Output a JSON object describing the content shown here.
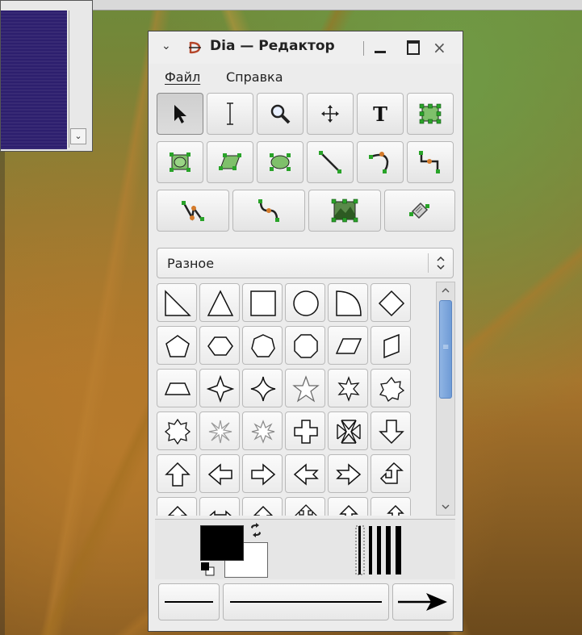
{
  "window": {
    "title": "Dia — Редактор",
    "menu_glyph": "⌄",
    "close_glyph": "×"
  },
  "menubar": {
    "file": "Файл",
    "help": "Справка"
  },
  "toolbox": {
    "tools": [
      {
        "name": "pointer-tool",
        "icon": "arrow-pointer-icon",
        "active": true
      },
      {
        "name": "text-edit-tool",
        "icon": "text-cursor-icon"
      },
      {
        "name": "magnify-tool",
        "icon": "magnifier-icon"
      },
      {
        "name": "scroll-tool",
        "icon": "move-icon"
      },
      {
        "name": "text-tool",
        "icon": "text-T-icon"
      },
      {
        "name": "box-tool",
        "icon": "box-icon"
      },
      {
        "name": "ellipse-box-tool",
        "icon": "ellipse-box-icon"
      },
      {
        "name": "polygon-tool",
        "icon": "parallelogram-icon"
      },
      {
        "name": "ellipse-tool",
        "icon": "ellipse-icon"
      },
      {
        "name": "line-tool",
        "icon": "line-icon"
      },
      {
        "name": "arc-tool",
        "icon": "arc-icon"
      },
      {
        "name": "zigzag-tool",
        "icon": "zigzag-line-icon"
      },
      {
        "name": "polyline-tool",
        "icon": "polyline-icon"
      },
      {
        "name": "bezier-tool",
        "icon": "bezier-icon"
      },
      {
        "name": "image-tool",
        "icon": "image-icon"
      },
      {
        "name": "outline-tool",
        "icon": "outline-icon"
      }
    ]
  },
  "sheet": {
    "selected": "Разное",
    "up_glyph": "⌃",
    "down_glyph": "⌄"
  },
  "scrollbar": {
    "up": "^",
    "down": "v",
    "grip": "≡"
  },
  "shapes": [
    "right-triangle-icon",
    "triangle-icon",
    "square-icon",
    "circle-icon",
    "quarter-circle-icon",
    "diamond-icon",
    "pentagon-icon",
    "hexagon-icon",
    "heptagon-icon",
    "octagon-icon",
    "parallelogram-icon",
    "slanted-quad-icon",
    "trapezoid-icon",
    "star4-icon",
    "star4-concave-icon",
    "star5-icon",
    "star6-icon",
    "star7-icon",
    "star8-icon",
    "burst-icon",
    "burst-outline-icon",
    "cross-icon",
    "maltese-cross-icon",
    "arrow-down-icon",
    "arrow-up-icon",
    "arrow-left-icon",
    "arrow-right-icon",
    "arrow-left-notched-icon",
    "arrow-right-notched-icon",
    "arrow-uturn-icon",
    "arrow-up-small-icon",
    "arrow-leftright-icon",
    "arrow-up-wide-icon",
    "arrow-quad-icon",
    "arrow-up-down-icon",
    "arrow-corner-icon"
  ],
  "colors": {
    "foreground": "#000000",
    "background": "#ffffff",
    "swap_glyph": "⇄"
  }
}
